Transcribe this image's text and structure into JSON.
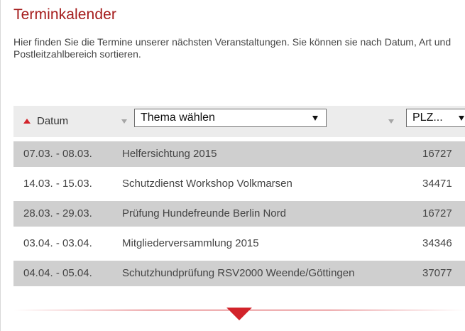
{
  "page": {
    "title": "Terminkalender",
    "intro": "Hier finden Sie die Termine unserer nächsten Veranstaltungen. Sie können sie nach Datum, Art und Postleitzahlbereich sortieren."
  },
  "table_header": {
    "datum_label": "Datum",
    "thema_select_value": "Thema wählen",
    "plz_select_value": "PLZ..."
  },
  "events": [
    {
      "date": "07.03. - 08.03.",
      "topic": "Helfersichtung 2015",
      "plz": "16727"
    },
    {
      "date": "14.03. - 15.03.",
      "topic": "Schutzdienst Workshop Volkmarsen",
      "plz": "34471"
    },
    {
      "date": "28.03. - 29.03.",
      "topic": "Prüfung Hundefreunde Berlin Nord",
      "plz": "16727"
    },
    {
      "date": "03.04. - 03.04.",
      "topic": "Mitgliederversammlung 2015",
      "plz": "34346"
    },
    {
      "date": "04.04. - 05.04.",
      "topic": "Schutzhundprüfung RSV2000 Weende/Göttingen",
      "plz": "37077"
    }
  ],
  "colors": {
    "accent": "#d2232a",
    "title": "#a51c1c",
    "row_shaded": "#cfcfcf",
    "header_bg": "#ececec"
  },
  "icons": {
    "sort_active": "sort-ascending-icon",
    "sort_inactive": "sort-descending-icon",
    "select_dropdown": "dropdown-triangle-icon",
    "load_more": "chevron-down-icon"
  }
}
